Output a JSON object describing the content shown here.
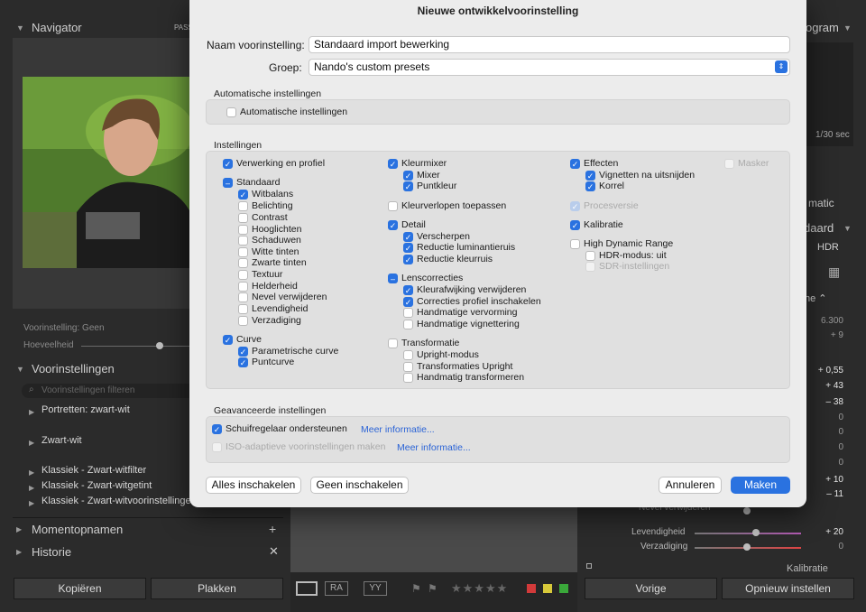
{
  "lightroom": {
    "navigator": {
      "title": "Navigator",
      "pass": "PASS"
    },
    "histogram_title": "ogram",
    "shutter": "1/30 sec",
    "preset_line": "Voorinstelling: Geen",
    "amount": "Hoeveelheid",
    "presets": {
      "title": "Voorinstellingen",
      "filter_placeholder": "Voorinstellingen filteren",
      "items": [
        "Portretten: zwart-wit",
        "Zwart-wit",
        "Klassiek - Zwart-witfilter",
        "Klassiek - Zwart-witgetint",
        "Klassiek - Zwart-witvoorinstellingen"
      ]
    },
    "snapshots": "Momentopnamen",
    "history": "Historie",
    "copy": "Kopiëren",
    "paste": "Plakken",
    "prev": "Vorige",
    "reset": "Opnieuw instellen",
    "right": {
      "matic": "matic",
      "standard": "daard",
      "hdr": "HDR",
      "he": "he ⌃",
      "v1": "6.300",
      "v2": "+ 9",
      "vals": [
        "+ 0,55",
        "+ 43",
        "– 38",
        "0",
        "0",
        "0",
        "0",
        "+ 10",
        "– 11"
      ],
      "nevel": "Nevel verwijderen",
      "levend": "Levendigheid",
      "levend_val": "+ 20",
      "verz": "Verzadiging",
      "verz_val": "0",
      "kalibratie": "Kalibratie"
    }
  },
  "dialog": {
    "title": "Nieuwe ontwikkelvoorinstelling",
    "name_label": "Naam voorinstelling:",
    "name_value": "Standaard import bewerking",
    "group_label": "Groep:",
    "group_value": "Nando's custom presets",
    "auto_section": "Automatische instellingen",
    "auto_cb": "Automatische instellingen",
    "settings_section": "Instellingen",
    "col1": {
      "verwerking": "Verwerking en profiel",
      "standaard": "Standaard",
      "witbalans": "Witbalans",
      "belichting": "Belichting",
      "contrast": "Contrast",
      "hooglichten": "Hooglichten",
      "schaduwen": "Schaduwen",
      "witte": "Witte tinten",
      "zwarte": "Zwarte tinten",
      "textuur": "Textuur",
      "helderheid": "Helderheid",
      "nevel": "Nevel verwijderen",
      "levendigheid": "Levendigheid",
      "verzadiging": "Verzadiging",
      "curve": "Curve",
      "parametrisch": "Parametrische curve",
      "puntcurve": "Puntcurve"
    },
    "col2": {
      "kleurmixer": "Kleurmixer",
      "mixer": "Mixer",
      "puntkleur": "Puntkleur",
      "kleurverlopen": "Kleurverlopen toepassen",
      "detail": "Detail",
      "verscherpen": "Verscherpen",
      "ruis_lum": "Reductie luminantieruis",
      "ruis_kleur": "Reductie kleurruis",
      "lens": "Lenscorrecties",
      "afwijking": "Kleurafwijking verwijderen",
      "profiel": "Correcties profiel inschakelen",
      "vervorming": "Handmatige vervorming",
      "vignettering": "Handmatige vignettering",
      "transformatie": "Transformatie",
      "upright": "Upright-modus",
      "trans_upright": "Transformaties Upright",
      "handmatig_trans": "Handmatig transformeren"
    },
    "col3": {
      "effecten": "Effecten",
      "vignetten": "Vignetten na uitsnijden",
      "korrel": "Korrel",
      "procesversie": "Procesversie",
      "kalibratie": "Kalibratie",
      "hdr": "High Dynamic Range",
      "hdr_modus": "HDR-modus: uit",
      "sdr": "SDR-instellingen"
    },
    "masker": "Masker",
    "advanced_section": "Geavanceerde instellingen",
    "slider_support": "Schuifregelaar ondersteunen",
    "more1": "Meer informatie...",
    "iso": "ISO-adaptieve voorinstellingen maken",
    "more2": "Meer informatie...",
    "enable_all": "Alles inschakelen",
    "enable_none": "Geen inschakelen",
    "cancel": "Annuleren",
    "make": "Maken"
  }
}
